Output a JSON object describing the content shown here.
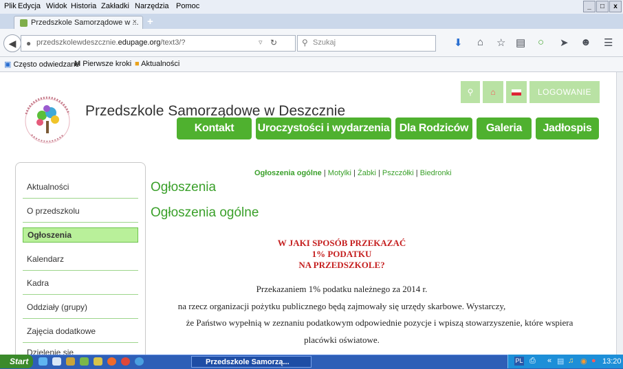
{
  "menu": [
    "Plik",
    "Edycja",
    "Widok",
    "Historia",
    "Zakładki",
    "Narzędzia",
    "Pomoc"
  ],
  "window_controls": [
    "_",
    "□",
    "x"
  ],
  "tab": {
    "title": "Przedszkole Samorządowe w ...",
    "close": "×"
  },
  "newtab": "+",
  "url": {
    "pre": "przedszkolewdeszcznie.",
    "host": "edupage.org",
    "post": "/text3/?"
  },
  "search": {
    "placeholder": "Szukaj"
  },
  "bookmarks": [
    "Często odwiedzane",
    "Pierwsze kroki",
    "Aktualności"
  ],
  "site": {
    "title": "Przedszkole Samorządowe w Deszcznie",
    "login": "LOGOWANIE",
    "nav": [
      "Kontakt",
      "Uroczystości i wydarzenia",
      "Dla Rodziców",
      "Galeria",
      "Jadłospis"
    ]
  },
  "sidebar": [
    "Aktualności",
    "O przedszkolu",
    "Ogłoszenia",
    "Kalendarz",
    "Kadra",
    "Oddziały (grupy)",
    "Zajęcia dodatkowe",
    "Dzielenie się"
  ],
  "subnav": {
    "current": "Ogłoszenia ogólne",
    "items": [
      "Motylki",
      "Żabki",
      "Pszczółki",
      "Biedronki"
    ]
  },
  "content": {
    "h1": "Ogłoszenia",
    "h2": "Ogłoszenia ogólne",
    "red": [
      "W JAKI SPOSÓB PRZEKAZAĆ",
      "1% PODATKU",
      "NA  PRZEDSZKOLE?"
    ],
    "body": [
      "Przekazaniem 1% podatku należnego za 2014 r.",
      "na rzecz organizacji pożytku publicznego będą zajmowały się urzędy skarbowe. Wystarczy,",
      "że Państwo wypełnią w zeznaniu podatkowym odpowiednie pozycje i wpiszą stowarzyszenie, które wspiera",
      "placówki oświatowe."
    ]
  },
  "taskbar": {
    "start": "Start",
    "item": "Przedszkole Samorzą...",
    "lang": "PL",
    "clock": "13:20"
  },
  "colors": {
    "green": "#4fb12f",
    "light_green": "#b9e2a4",
    "red_text": "#c52020"
  }
}
